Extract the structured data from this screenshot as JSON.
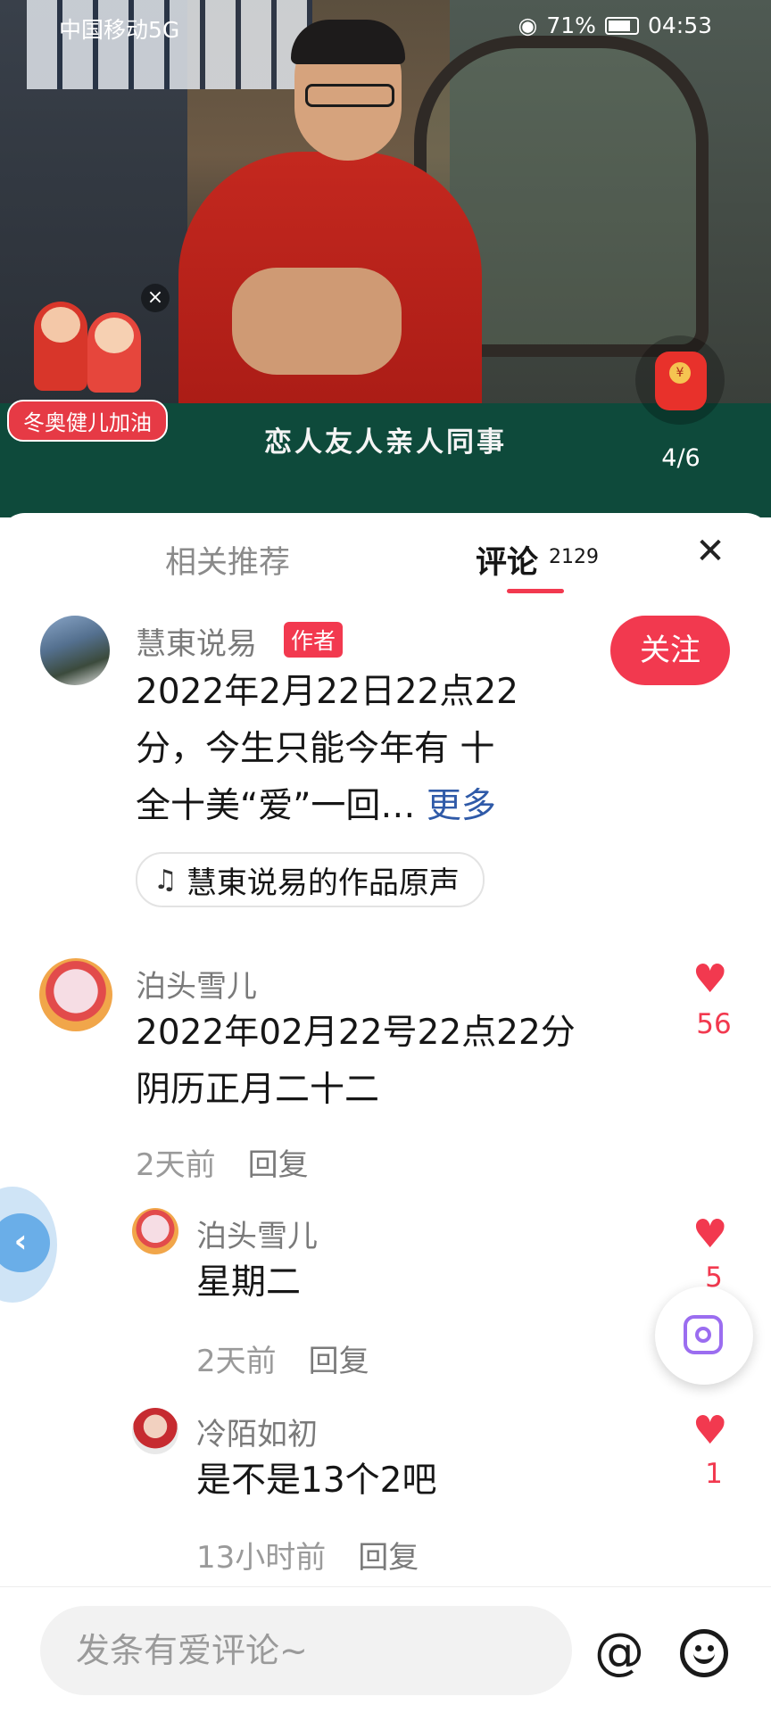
{
  "status_bar": {
    "carrier": "中国移动5G",
    "battery": "71%",
    "time": "04:53"
  },
  "video": {
    "subtitle": "恋人友人亲人同事",
    "promo_label": "冬奥健儿加油",
    "redpacket_count": "4/6"
  },
  "tabs": {
    "related": "相关推荐",
    "comments": "评论",
    "comments_count": "2129"
  },
  "author_post": {
    "name": "慧東说易",
    "badge": "作者",
    "follow": "关注",
    "text_line1": "2022年2月22日22点22",
    "text_line2": "分，今生只能今年有  十",
    "text_line3": "全十美“爱”一回…",
    "more": "更多",
    "music": "慧東说易的作品原声"
  },
  "comments": [
    {
      "name": "泊头雪儿",
      "line1": "2022年02月22号22点22分",
      "line2": "阴历正月二十二",
      "time": "2天前",
      "reply": "回复",
      "likes": "56"
    },
    {
      "name": "泊头雪儿",
      "line1": "星期二",
      "time": "2天前",
      "reply": "回复",
      "likes": "5"
    },
    {
      "name": "冷陌如初",
      "line1": "是不是13个2吧",
      "time": "13小时前",
      "reply": "回复",
      "likes": "1"
    }
  ],
  "input": {
    "placeholder": "发条有爱评论~",
    "at_icon": "@"
  },
  "colors": {
    "accent": "#f2394f",
    "link": "#2f5aa8",
    "subtitle_bg": "#0e4a3b"
  }
}
